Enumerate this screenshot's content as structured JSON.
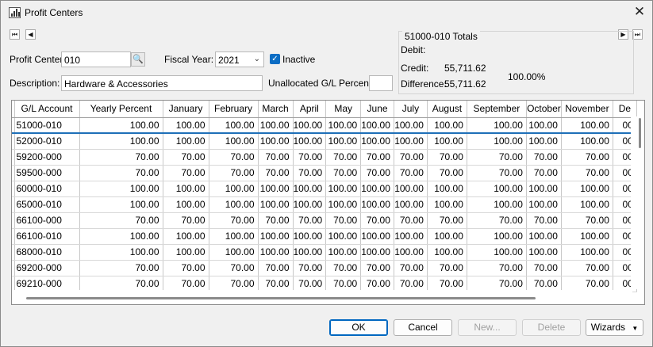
{
  "window": {
    "title": "Profit Centers",
    "close_glyph": "✕"
  },
  "nav": {
    "first": "⏮",
    "prev": "◀",
    "next": "▶",
    "last": "⏭"
  },
  "form": {
    "profit_center_label": "Profit Center:",
    "profit_center_value": "010",
    "fiscal_year_label": "Fiscal Year:",
    "fiscal_year_value": "2021",
    "inactive_label": "Inactive",
    "inactive_checked": true,
    "description_label": "Description:",
    "description_value": "Hardware & Accessories",
    "unallocated_label": "Unallocated G/L Percent:",
    "unallocated_value": ""
  },
  "totals": {
    "title": "51000-010 Totals",
    "debit_label": "Debit:",
    "debit_value": "",
    "credit_label": "Credit:",
    "credit_value": "55,711.62",
    "difference_label": "Difference:",
    "difference_value": "55,711.62",
    "percent": "100.00%"
  },
  "grid": {
    "columns": [
      "G/L Account",
      "Yearly Percent",
      "January",
      "February",
      "March",
      "April",
      "May",
      "June",
      "July",
      "August",
      "September",
      "October",
      "November",
      "De"
    ],
    "rows": [
      [
        "51000-010",
        "100.00",
        "100.00",
        "100.00",
        "100.00",
        "100.00",
        "100.00",
        "100.00",
        "100.00",
        "100.00",
        "100.00",
        "100.00",
        "100.00",
        "00"
      ],
      [
        "52000-010",
        "100.00",
        "100.00",
        "100.00",
        "100.00",
        "100.00",
        "100.00",
        "100.00",
        "100.00",
        "100.00",
        "100.00",
        "100.00",
        "100.00",
        "00"
      ],
      [
        "59200-000",
        "70.00",
        "70.00",
        "70.00",
        "70.00",
        "70.00",
        "70.00",
        "70.00",
        "70.00",
        "70.00",
        "70.00",
        "70.00",
        "70.00",
        "00"
      ],
      [
        "59500-000",
        "70.00",
        "70.00",
        "70.00",
        "70.00",
        "70.00",
        "70.00",
        "70.00",
        "70.00",
        "70.00",
        "70.00",
        "70.00",
        "70.00",
        "00"
      ],
      [
        "60000-010",
        "100.00",
        "100.00",
        "100.00",
        "100.00",
        "100.00",
        "100.00",
        "100.00",
        "100.00",
        "100.00",
        "100.00",
        "100.00",
        "100.00",
        "00"
      ],
      [
        "65000-010",
        "100.00",
        "100.00",
        "100.00",
        "100.00",
        "100.00",
        "100.00",
        "100.00",
        "100.00",
        "100.00",
        "100.00",
        "100.00",
        "100.00",
        "00"
      ],
      [
        "66100-000",
        "70.00",
        "70.00",
        "70.00",
        "70.00",
        "70.00",
        "70.00",
        "70.00",
        "70.00",
        "70.00",
        "70.00",
        "70.00",
        "70.00",
        "00"
      ],
      [
        "66100-010",
        "100.00",
        "100.00",
        "100.00",
        "100.00",
        "100.00",
        "100.00",
        "100.00",
        "100.00",
        "100.00",
        "100.00",
        "100.00",
        "100.00",
        "00"
      ],
      [
        "68000-010",
        "100.00",
        "100.00",
        "100.00",
        "100.00",
        "100.00",
        "100.00",
        "100.00",
        "100.00",
        "100.00",
        "100.00",
        "100.00",
        "100.00",
        "00"
      ],
      [
        "69200-000",
        "70.00",
        "70.00",
        "70.00",
        "70.00",
        "70.00",
        "70.00",
        "70.00",
        "70.00",
        "70.00",
        "70.00",
        "70.00",
        "70.00",
        "00"
      ],
      [
        "69210-000",
        "70.00",
        "70.00",
        "70.00",
        "70.00",
        "70.00",
        "70.00",
        "70.00",
        "70.00",
        "70.00",
        "70.00",
        "70.00",
        "70.00",
        "00"
      ]
    ]
  },
  "buttons": {
    "ok": "OK",
    "cancel": "Cancel",
    "new": "New...",
    "delete": "Delete",
    "wizards": "Wizards",
    "wizards_arrow": "▼"
  },
  "colors": {
    "accent": "#0b6dc4",
    "selection_line": "#1e6fb8"
  }
}
